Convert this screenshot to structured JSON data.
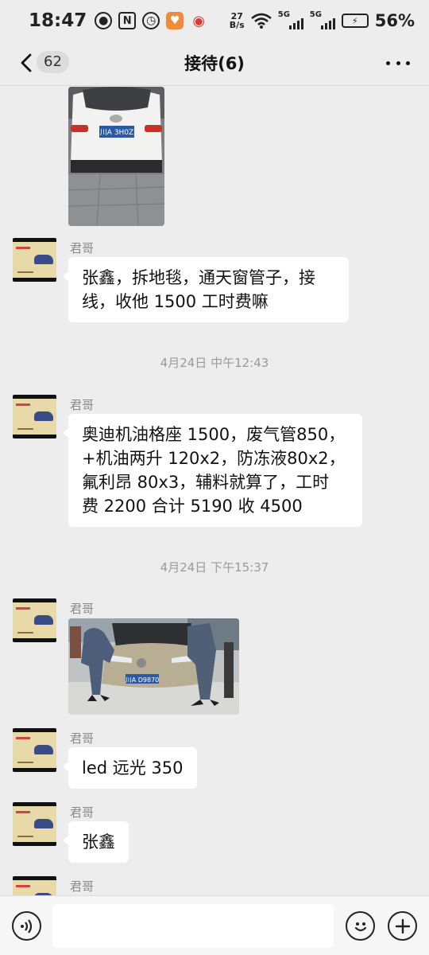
{
  "status_bar": {
    "time": "18:47",
    "net_speed_value": "27",
    "net_speed_unit": "B/s",
    "signal1_label": "5G",
    "signal2_label": "5G",
    "battery_percent": "56%",
    "icons": [
      "eye-icon",
      "nfc-icon",
      "alarm-icon",
      "taobao-app-icon",
      "weibo-app-icon",
      "wifi-icon",
      "signal-icon",
      "battery-charging-icon"
    ]
  },
  "nav": {
    "unread_count": "62",
    "title": "接待(6)"
  },
  "messages": [
    {
      "type": "image",
      "desc": "white-car-rear"
    },
    {
      "type": "text",
      "sender": "君哥",
      "text": "张鑫，拆地毯，通天窗管子，接线，收他 1500 工时费嘛",
      "lines": [
        "张鑫，拆地毯，通天窗管子，接",
        "线，收他 1500 工时费嘛"
      ]
    },
    {
      "type": "time",
      "text": "4月24日 中午12:43"
    },
    {
      "type": "text",
      "sender": "君哥",
      "text": "奥迪机油格座 1500，废气管850，+机油两升 120x2，防冻液80x2，氟利昂 80x3，辅料就算了，工时费 2200 合计 5190 收 4500",
      "lines": [
        "奥迪机油格座 1500，废气管850，",
        "+机油两升 120x2，防冻液80x2，",
        "氟利昂 80x3，辅料就算了，工时",
        "费 2200 合计 5190 收 4500"
      ]
    },
    {
      "type": "time",
      "text": "4月24日 下午15:37"
    },
    {
      "type": "image",
      "sender": "君哥",
      "desc": "peugeot-in-workshop"
    },
    {
      "type": "text",
      "sender": "君哥",
      "text": "led 远光 350"
    },
    {
      "type": "text",
      "sender": "君哥",
      "text": "张鑫"
    },
    {
      "type": "partial",
      "sender": "君哥"
    }
  ],
  "plates": {
    "white_car": "川A 3H0Z",
    "peugeot": "川A D9870"
  },
  "colors": {
    "background": "#ededed",
    "bubble": "#ffffff",
    "timestamp": "#9a9a9a",
    "sender": "#8a8a8a"
  }
}
